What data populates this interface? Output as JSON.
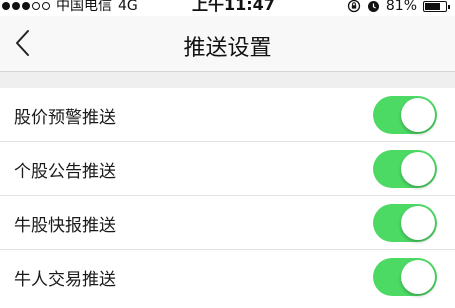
{
  "status_bar": {
    "carrier": "中国电信",
    "network": "4G",
    "time": "上午11:47",
    "battery_percent": "81%",
    "battery_level": 0.81,
    "signal_bars_filled": 3,
    "signal_bars_total": 5
  },
  "nav": {
    "back_icon": "chevron-left-icon",
    "title": "推送设置"
  },
  "settings": {
    "items": [
      {
        "label": "股价预警推送",
        "enabled": true
      },
      {
        "label": "个股公告推送",
        "enabled": true
      },
      {
        "label": "牛股快报推送",
        "enabled": true
      },
      {
        "label": "牛人交易推送",
        "enabled": true
      }
    ]
  },
  "colors": {
    "toggle_on": "#4cd964",
    "toggle_off": "#e5e5e5",
    "nav_background": "#f8f8f8",
    "page_background": "#efefef"
  }
}
